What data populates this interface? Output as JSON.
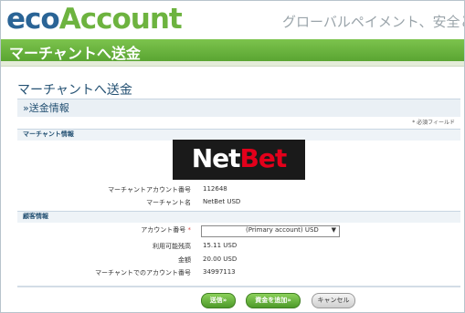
{
  "header": {
    "logo_eco": "eco",
    "logo_account": "Account",
    "tagline": "グローバルペイメント、安全と簡単",
    "title_bar": "マーチャントへ送金"
  },
  "page": {
    "title": "マーチャントへ送金",
    "section": "»送金情報",
    "required_note": "* 必須フィールド"
  },
  "merchant": {
    "group_title": "マーチャント情報",
    "logo_part1": "Net",
    "logo_part2": "Bet",
    "account_label": "マーチャントアカウント番号",
    "account_value": "112648",
    "name_label": "マーチャント名",
    "name_value": "NetBet USD"
  },
  "customer": {
    "group_title": "顧客情報",
    "account_no_label": "アカウント番号",
    "required_mark": "*",
    "account_select_value": "(Primary account) USD",
    "available_label": "利用可能残高",
    "available_value": "15.11 USD",
    "amount_label": "金額",
    "amount_value": "20.00 USD",
    "merchant_acct_label": "マーチャントでのアカウント番号",
    "merchant_acct_value": "34997113"
  },
  "buttons": {
    "send": "送信»",
    "add_funds": "資金を追加»",
    "cancel": "キャンセル"
  }
}
